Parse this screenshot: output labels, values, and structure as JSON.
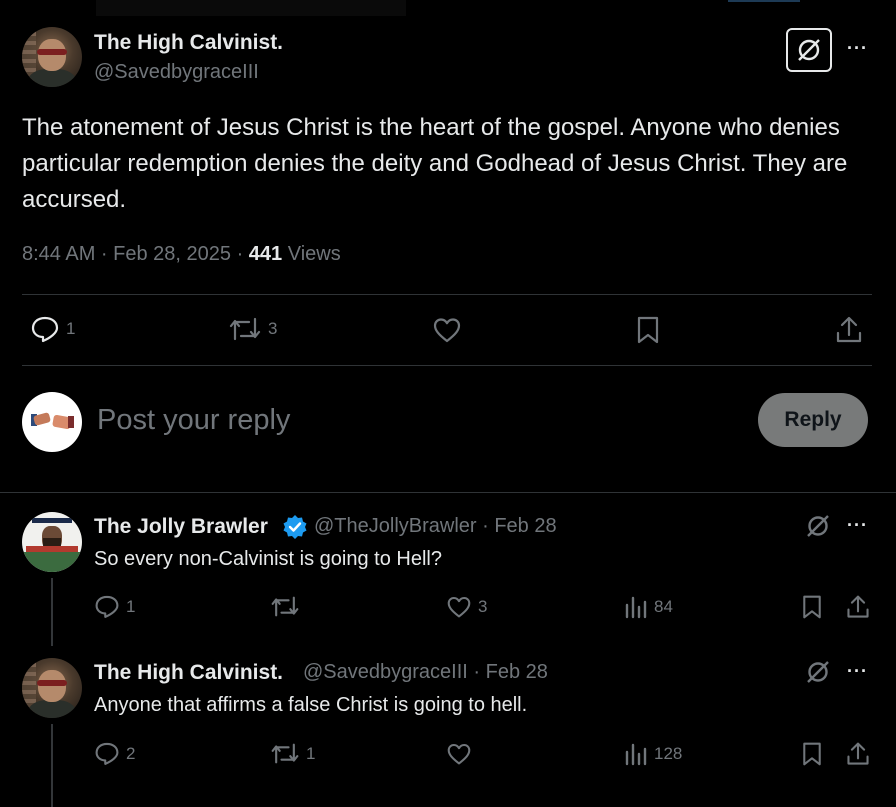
{
  "main_tweet": {
    "author_name": "The High Calvinist.",
    "author_handle": "@SavedbygraceIII",
    "text": "The atonement of Jesus Christ is the heart of the gospel. Anyone who denies particular redemption denies the deity and Godhead of Jesus Christ. They are accursed.",
    "time": "8:44 AM · Feb 28, 2025 · ",
    "views_count": "441",
    "views_label": " Views",
    "replies": "1",
    "reposts": "3",
    "more": "···"
  },
  "composer": {
    "placeholder": "Post your reply",
    "button": "Reply"
  },
  "replies": [
    {
      "name": "The Jolly Brawler",
      "handle_date": "@TheJollyBrawler · Feb 28",
      "text": "So every non-Calvinist is going to Hell?",
      "replies": "1",
      "reposts": "",
      "likes": "3",
      "views": "84",
      "verified": true
    },
    {
      "name": "The High Calvinist.",
      "handle_date": "@SavedbygraceIII · Feb 28",
      "text": "Anyone that affirms a false Christ is going to hell.",
      "replies": "2",
      "reposts": "1",
      "likes": "",
      "views": "128",
      "verified": false
    }
  ],
  "colors": {
    "background": "#000000",
    "text": "#e7e9ea",
    "muted": "#71767b",
    "border": "#2f3336",
    "accent": "#1d9bf0"
  }
}
